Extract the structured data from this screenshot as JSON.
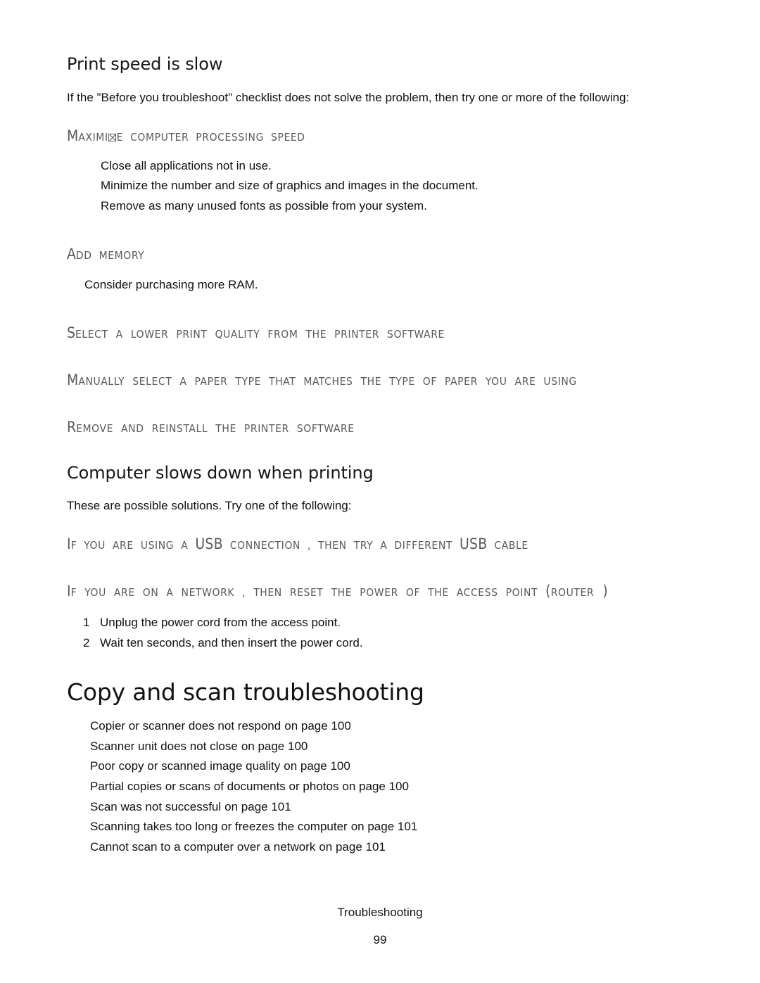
{
  "document": {
    "footer_title": "Troubleshooting",
    "page_number": "99"
  },
  "topic_print_speed": {
    "title": "Print speed is slow",
    "intro": "If the \"Before you troubleshoot\" checklist does not solve the problem, then try one or more of the following:",
    "procedures": [
      {
        "head_cap": "M",
        "head_rest_a": "AXIMI",
        "head_glyph": "missing-glyph-box",
        "head_rest_b": "E  COMPUTER  PROCESSING  SPEED",
        "steps": [
          "Close all applications not in use.",
          "Minimize the number and size of graphics and images in the document.",
          "Remove as many unused fonts as possible from your system."
        ]
      },
      {
        "head_cap": "A",
        "head_rest": "DD MEMORY",
        "steps": [
          "Consider purchasing more RAM."
        ]
      },
      {
        "head_cap": "S",
        "head_rest": "ELECT  A LOWER  PRINT  QUALITY  FROM  THE  PRINTER  SOFTWARE",
        "steps": []
      },
      {
        "head_cap": "M",
        "head_rest": "ANUALLY  SELECT  A PAPER  TYPE  THAT MATCHES  THE TYPE  OF PAPER  YOU  ARE  USING",
        "steps": []
      },
      {
        "head_cap": "R",
        "head_rest": "EMOVE  AND REINSTALL  THE  PRINTER  SOFTWARE",
        "steps": []
      }
    ]
  },
  "topic_computer_slows": {
    "title": "Computer slows down when printing",
    "intro": "These are possible solutions. Try one of the following:",
    "proc_usb": {
      "cap": "I",
      "part1": "F  YOU  ARE  USING  A ",
      "usb1": "USB",
      "part2": "  CONNECTION , THEN  TRY  A DIFFERENT  ",
      "usb2": "USB",
      "part3": "  CABLE"
    },
    "proc_network": {
      "cap": "I",
      "part1": "F  YOU  ARE  ON A NETWORK , THEN  RESET  THE  POWER  OF  THE  ACCESS  POINT ",
      "paren_open": "(",
      "router": "ROUTER",
      "paren_close": " )"
    },
    "steps": [
      {
        "num": "1",
        "text": "Unplug the power cord from the access point."
      },
      {
        "num": "2",
        "text": "Wait ten seconds, and then insert the power cord."
      }
    ]
  },
  "section_copy_scan": {
    "title": "Copy and scan troubleshooting",
    "links": [
      {
        "label": "Copier or scanner does not respond",
        "page": "on page 100"
      },
      {
        "label": "Scanner unit does not close",
        "page": "on page 100"
      },
      {
        "label": "Poor copy or scanned image quality",
        "page": "on page 100"
      },
      {
        "label": "Partial copies or scans of documents or photos",
        "page": "on page 100"
      },
      {
        "label": "Scan was not successful",
        "page": "on page 101"
      },
      {
        "label": "Scanning takes too long or freezes the computer",
        "page": "on page 101"
      },
      {
        "label": "Cannot scan to a computer over a network",
        "page": "on page 101"
      }
    ]
  }
}
